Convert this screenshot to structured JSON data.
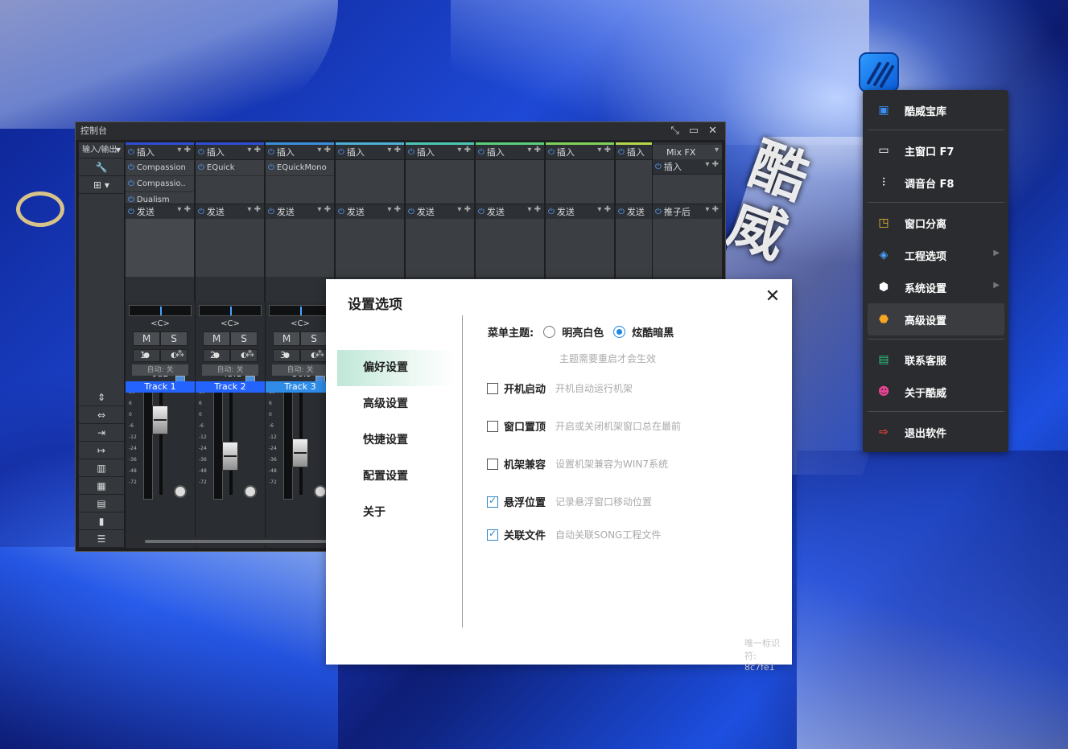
{
  "console": {
    "title": "控制台",
    "io_label": "输入/输出",
    "channels": [
      {
        "top_color": "#2f4fd8",
        "plugins": [
          "Compassion",
          "Compassio..",
          "Dualism"
        ],
        "pan": "<C>",
        "volume": "0dB",
        "fader_pos": 0.18,
        "number": "1",
        "auto": "自动: 关",
        "name": "Track 1",
        "name_bg": "#2563ff"
      },
      {
        "top_color": "#2f4fd8",
        "plugins": [
          "EQuick"
        ],
        "pan": "<C>",
        "volume": "-43.1",
        "fader_pos": 0.62,
        "number": "2",
        "auto": "自动: 关",
        "name": "Track 2",
        "name_bg": "#2563ff"
      },
      {
        "top_color": "#3a8fe0",
        "plugins": [
          "EQuickMono"
        ],
        "pan": "<C>",
        "volume": "-36.5",
        "fader_pos": 0.58,
        "number": "3",
        "auto": "自动: 关",
        "name": "Track 3",
        "name_bg": "#2f8de8"
      },
      {
        "top_color": "#4db3d6",
        "plugins": [],
        "name": ""
      },
      {
        "top_color": "#4cc7b5",
        "plugins": [],
        "name": ""
      },
      {
        "top_color": "#5bcf7d",
        "plugins": [],
        "name": ""
      },
      {
        "top_color": "#7fd35a",
        "plugins": [],
        "name": ""
      },
      {
        "top_color": "#b6d84a",
        "plugins": [],
        "name": ""
      }
    ],
    "insert_label": "插入",
    "send_label": "发送",
    "mute_label": "M",
    "solo_label": "S",
    "fx": {
      "name": "Mix FX",
      "insert_label": "插入",
      "send_label": "推子后"
    },
    "scale_ticks": [
      "10",
      "6",
      "0",
      "-6",
      "-12",
      "-24",
      "-36",
      "-48",
      "-72"
    ]
  },
  "settings": {
    "title": "设置选项",
    "close_icon": "close-icon",
    "nav": [
      {
        "label": "偏好设置",
        "active": true
      },
      {
        "label": "高级设置",
        "active": false
      },
      {
        "label": "快捷设置",
        "active": false
      },
      {
        "label": "配置设置",
        "active": false
      },
      {
        "label": "关于",
        "active": false
      }
    ],
    "theme": {
      "label": "菜单主题:",
      "options": [
        {
          "label": "明亮白色",
          "selected": false
        },
        {
          "label": "炫酷暗黑",
          "selected": true
        }
      ],
      "hint": "主题需要重启才会生效"
    },
    "options": [
      {
        "label": "开机启动",
        "desc": "开机自动运行机架",
        "checked": false
      },
      {
        "label": "窗口置顶",
        "desc": "开启或关闭机架窗口总在最前",
        "checked": false
      },
      {
        "label": "机架兼容",
        "desc": "设置机架兼容为WIN7系统",
        "checked": false
      },
      {
        "label": "悬浮位置",
        "desc": "记录悬浮窗口移动位置",
        "checked": true
      },
      {
        "label": "关联文件",
        "desc": "自动关联SONG工程文件",
        "checked": true
      }
    ],
    "uid": "唯一标识符: 8c7fe1"
  },
  "tray_menu": {
    "items": [
      {
        "label": "酷威宝库",
        "icon": "music-library-icon",
        "icon_color": "#3a8ff0",
        "submenu": false
      },
      {
        "label": "主窗口 F7",
        "icon": "window-icon",
        "icon_color": "#ffffff",
        "submenu": false
      },
      {
        "label": "调音台 F8",
        "icon": "sliders-icon",
        "icon_color": "#ffffff",
        "submenu": false
      },
      {
        "label": "窗口分离",
        "icon": "split-window-icon",
        "icon_color": "#f2c230",
        "submenu": false
      },
      {
        "label": "工程选项",
        "icon": "layers-icon",
        "icon_color": "#4aa3ff",
        "submenu": true
      },
      {
        "label": "系统设置",
        "icon": "cube-icon",
        "icon_color": "#ffffff",
        "submenu": true
      },
      {
        "label": "高级设置",
        "icon": "hexagon-icon",
        "icon_color": "#f5a623",
        "submenu": false,
        "highlight": true
      },
      {
        "label": "联系客服",
        "icon": "support-icon",
        "icon_color": "#2ec27e",
        "submenu": false
      },
      {
        "label": "关于酷威",
        "icon": "user-icon",
        "icon_color": "#e84393",
        "submenu": false
      },
      {
        "label": "退出软件",
        "icon": "exit-icon",
        "icon_color": "#e8453c",
        "submenu": false
      }
    ]
  },
  "background": {
    "brand_text": "酷威"
  }
}
